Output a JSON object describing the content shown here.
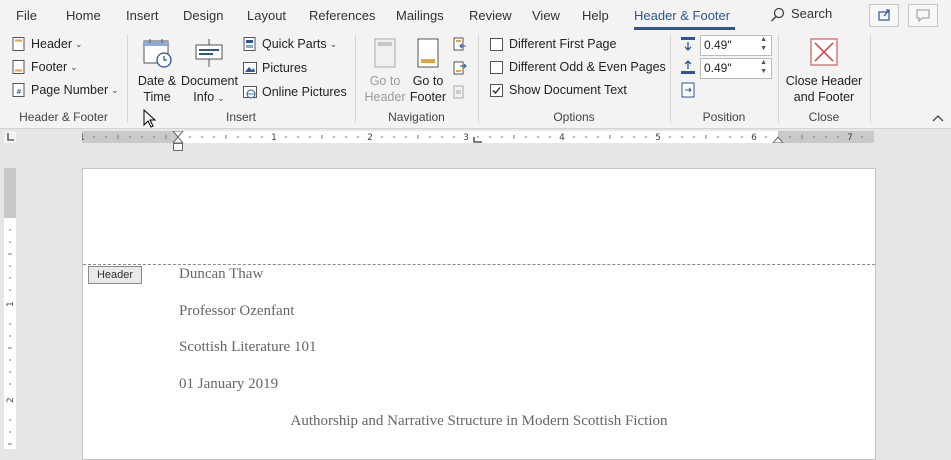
{
  "menu": {
    "tabs": [
      "File",
      "Home",
      "Insert",
      "Design",
      "Layout",
      "References",
      "Mailings",
      "Review",
      "View",
      "Help",
      "Header & Footer"
    ],
    "search": "Search"
  },
  "ribbon": {
    "hf_group": {
      "header": "Header",
      "footer": "Footer",
      "page_number": "Page Number",
      "label": "Header & Footer"
    },
    "insert_group": {
      "date_time_1": "Date &",
      "date_time_2": "Time",
      "doc_info_1": "Document",
      "doc_info_2": "Info",
      "quick_parts": "Quick Parts",
      "pictures": "Pictures",
      "online_pictures": "Online Pictures",
      "label": "Insert"
    },
    "navigation_group": {
      "go_header_1": "Go to",
      "go_header_2": "Header",
      "go_footer_1": "Go to",
      "go_footer_2": "Footer",
      "label": "Navigation"
    },
    "options_group": {
      "diff_first": "Different First Page",
      "diff_odd_even": "Different Odd & Even Pages",
      "show_doc_text": "Show Document Text",
      "label": "Options"
    },
    "position_group": {
      "header_from_top": "0.49\"",
      "footer_from_bottom": "0.49\"",
      "label": "Position"
    },
    "close_group": {
      "close_1": "Close Header",
      "close_2": "and Footer",
      "label": "Close"
    }
  },
  "ruler": {
    "h_numbers": [
      "1",
      "1",
      "2",
      "3",
      "4",
      "5",
      "6",
      "7"
    ],
    "v_numbers": [
      "1",
      "2"
    ]
  },
  "document": {
    "header_tag": "Header",
    "lines": [
      "Duncan Thaw",
      "Professor Ozenfant",
      "Scottish Literature 101",
      "01 January 2019"
    ],
    "title": "Authorship and Narrative Structure in Modern Scottish Fiction"
  }
}
